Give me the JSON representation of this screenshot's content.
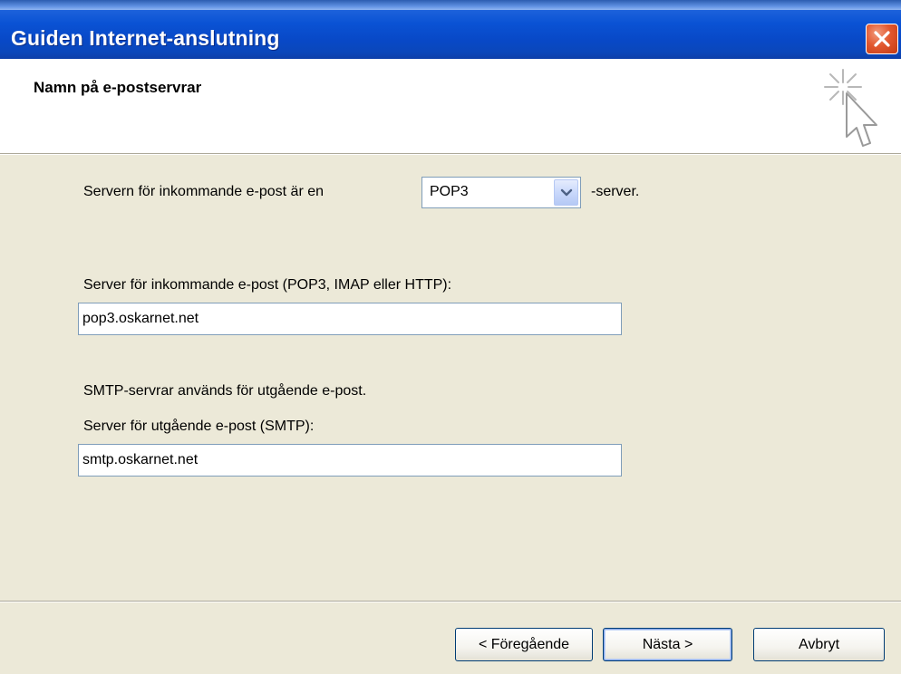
{
  "window": {
    "title": "Guiden Internet-anslutning"
  },
  "header": {
    "title": "Namn på e-postservrar"
  },
  "server_type": {
    "prefix": "Servern för inkommande e-post är en",
    "selected": "POP3",
    "suffix": "-server."
  },
  "incoming": {
    "label": "Server för inkommande e-post (POP3, IMAP eller HTTP):",
    "value": "pop3.oskarnet.net"
  },
  "smtp_info": "SMTP-servrar används för utgående e-post.",
  "outgoing": {
    "label": "Server för utgående e-post (SMTP):",
    "value": "smtp.oskarnet.net"
  },
  "buttons": {
    "back": "< Föregående",
    "next": "Nästa >",
    "cancel": "Avbryt"
  },
  "icons": {
    "close": "close-icon",
    "wizard": "wizard-sparkle-cursor-icon",
    "dropdown": "chevron-down-icon"
  },
  "colors": {
    "titlebar": "#0a52d4",
    "dialog_bg": "#ece9d8",
    "close_button": "#e2582f"
  }
}
